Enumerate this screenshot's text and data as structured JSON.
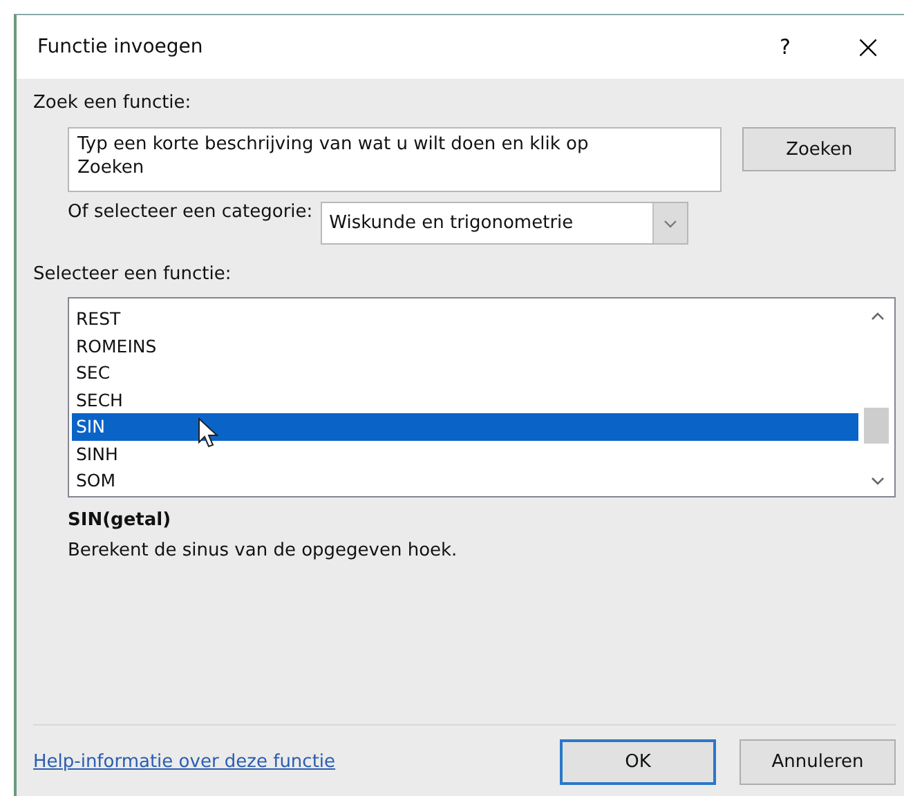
{
  "window": {
    "title": "Functie invoegen",
    "help": "?",
    "close": "×"
  },
  "search": {
    "label": "Zoek een functie:",
    "value": "Typ een korte beschrijving van wat u wilt doen en klik op Zoeken",
    "button": "Zoeken"
  },
  "category": {
    "label": "Of selecteer een categorie:",
    "value": "Wiskunde en trigonometrie"
  },
  "functions": {
    "label": "Selecteer een functie:",
    "items": [
      {
        "name": "REST",
        "selected": false
      },
      {
        "name": "ROMEINS",
        "selected": false
      },
      {
        "name": "SEC",
        "selected": false
      },
      {
        "name": "SECH",
        "selected": false
      },
      {
        "name": "SIN",
        "selected": true
      },
      {
        "name": "SINH",
        "selected": false
      },
      {
        "name": "SOM",
        "selected": false
      }
    ]
  },
  "syntax": "SIN(getal)",
  "description": "Berekent de sinus van de opgegeven hoek.",
  "help_link": "Help-informatie over deze functie",
  "buttons": [
    {
      "label": "OK",
      "default": true
    },
    {
      "label": "Annuleren",
      "default": false
    }
  ]
}
